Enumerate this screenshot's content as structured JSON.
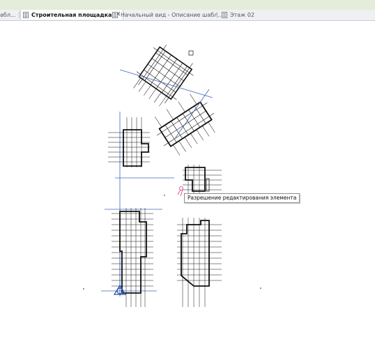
{
  "tabs": [
    {
      "label": "абл...",
      "active": false
    },
    {
      "label": "Строительная площадка",
      "active": true,
      "close": "✕"
    },
    {
      "label": "Начальный вид - Описание шабл...",
      "active": false
    },
    {
      "label": "Этаж 02",
      "active": false
    }
  ],
  "tooltip": {
    "text": "Разрешение редактирования элемента"
  },
  "colors": {
    "grid_line": "#3a67b8",
    "drawing": "#111111",
    "pin": "#d5569f"
  },
  "icons": [
    "document-icon",
    "close-icon",
    "pin-icon",
    "project-base-point-icon"
  ]
}
